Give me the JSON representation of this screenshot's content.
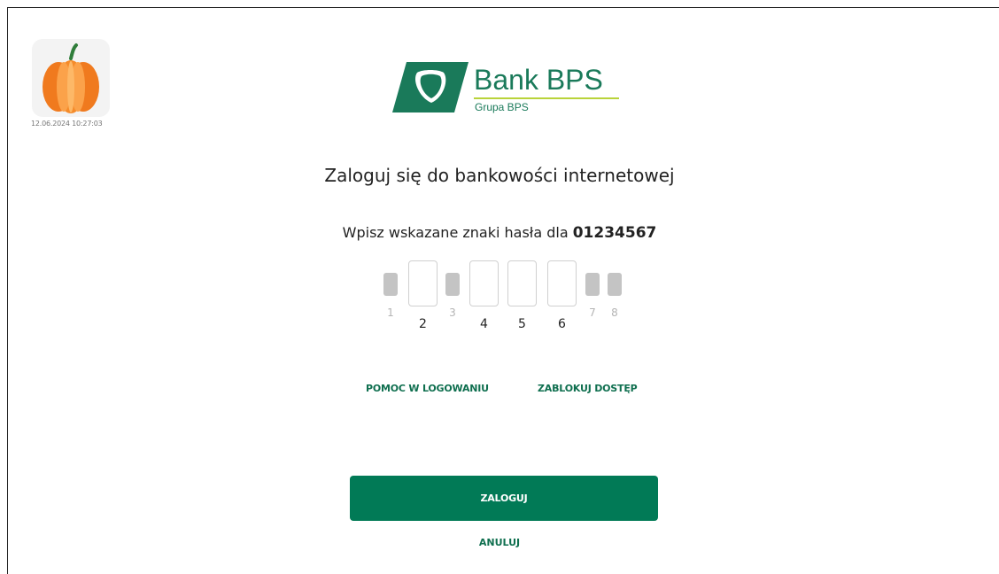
{
  "avatar": {
    "icon": "pumpkin-icon",
    "timestamp": "12.06.2024 10:27:03"
  },
  "logo": {
    "brand": "Bank BPS",
    "group": "Grupa BPS",
    "color": "#1a7a5a",
    "accent": "#b9d33a"
  },
  "title": "Zaloguj się do bankowości internetowej",
  "instruction": {
    "text": "Wpisz wskazane znaki hasła dla ",
    "login": "01234567"
  },
  "password_positions": [
    {
      "label": "1",
      "active": false
    },
    {
      "label": "2",
      "active": true
    },
    {
      "label": "3",
      "active": false
    },
    {
      "label": "4",
      "active": true
    },
    {
      "label": "5",
      "active": true
    },
    {
      "label": "6",
      "active": true
    },
    {
      "label": "7",
      "active": false
    },
    {
      "label": "8",
      "active": false
    }
  ],
  "links": {
    "help": "POMOC W LOGOWANIU",
    "block": "ZABLOKUJ DOSTĘP"
  },
  "buttons": {
    "login": "ZALOGUJ",
    "cancel": "ANULUJ"
  },
  "colors": {
    "primary": "#017a56",
    "link": "#0f6f4f"
  }
}
